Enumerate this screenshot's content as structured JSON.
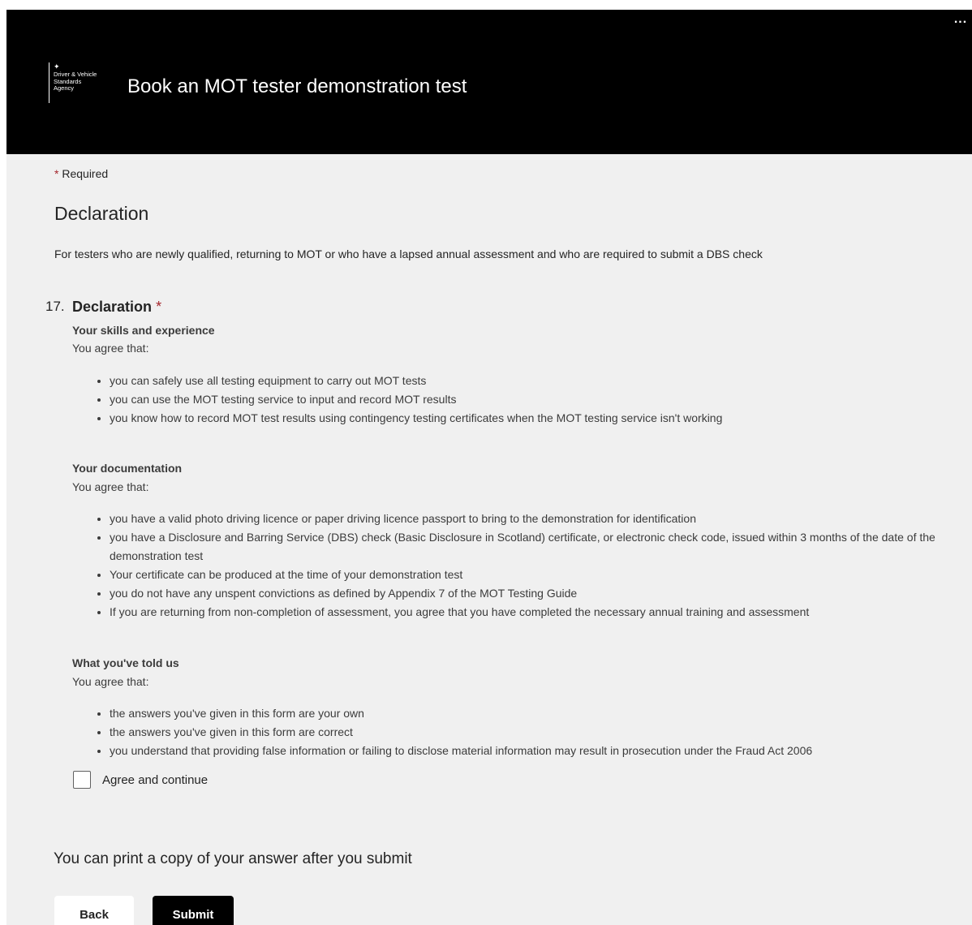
{
  "header": {
    "more_label": "...",
    "logo": {
      "crest": "✦",
      "lines": [
        "Driver & Vehicle",
        "Standards",
        "Agency"
      ]
    },
    "title": "Book an MOT tester demonstration test"
  },
  "form": {
    "required_marker": "*",
    "required_label": "Required",
    "section_title": "Declaration",
    "section_description": "For testers who are newly qualified, returning to MOT or who have a lapsed annual assessment and who are required to submit a DBS check",
    "question": {
      "number": "17.",
      "title": "Declaration",
      "required_marker": "*",
      "blocks": [
        {
          "heading": "Your skills and experience",
          "intro": "You agree that:",
          "items": [
            "you can safely use all testing equipment to carry out MOT tests",
            "you can use the MOT testing service to input and record MOT results",
            "you know how to record MOT test results using contingency testing certificates when the MOT testing service isn't working"
          ]
        },
        {
          "heading": "Your documentation",
          "intro": "You agree that:",
          "items": [
            "you have a valid photo driving licence or paper driving licence  passport to bring to the demonstration for identification",
            "you have a Disclosure and Barring Service (DBS) check (Basic Disclosure in Scotland) certificate, or electronic check code, issued within 3 months of the date of the demonstration test",
            "Your certificate can be produced at the time of your demonstration test",
            "you do not have any unspent convictions as defined by Appendix 7 of the MOT Testing Guide",
            "If you are returning from non-completion of assessment, you agree that you have completed the necessary annual training and assessment"
          ]
        },
        {
          "heading": "What you've told us",
          "intro": "You agree that:",
          "items": [
            "the answers you've given in this form are your own",
            "the answers you've given in this form are correct",
            "you understand that providing false information or failing to disclose material information may result in prosecution under the Fraud Act 2006"
          ]
        }
      ],
      "checkbox": {
        "label": "Agree and continue",
        "checked": false
      }
    },
    "print_note": "You can print a copy of your answer after you submit",
    "buttons": {
      "back": "Back",
      "submit": "Submit"
    }
  },
  "colors": {
    "header_bg": "#000000",
    "page_bg": "#f0f0f0",
    "required_red": "#a4262c",
    "submit_bg": "#000000"
  }
}
